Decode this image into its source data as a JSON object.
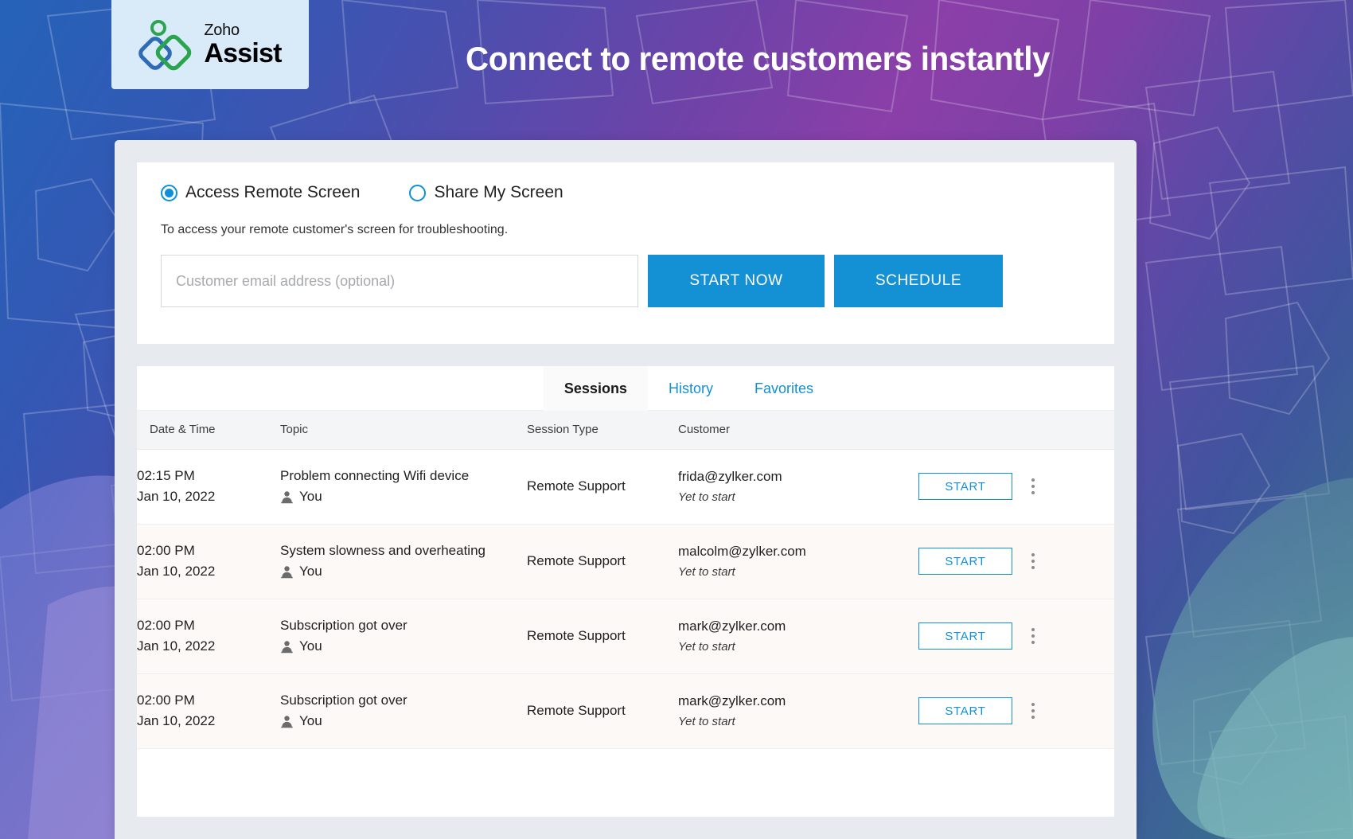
{
  "header": {
    "logo": {
      "brand_top": "Zoho",
      "brand_main": "Assist",
      "icon": "zoho-assist-logo-icon"
    },
    "headline": "Connect to remote customers instantly"
  },
  "connect_panel": {
    "options": [
      {
        "label": "Access Remote Screen",
        "selected": true
      },
      {
        "label": "Share My Screen",
        "selected": false
      }
    ],
    "description": "To access your remote customer's screen for troubleshooting.",
    "email_placeholder": "Customer email address (optional)",
    "email_value": "",
    "start_now_label": "START NOW",
    "schedule_label": "SCHEDULE"
  },
  "sessions_panel": {
    "tabs": [
      {
        "label": "Sessions",
        "active": true
      },
      {
        "label": "History",
        "active": false
      },
      {
        "label": "Favorites",
        "active": false
      }
    ],
    "columns": [
      "Date & Time",
      "Topic",
      "Session Type",
      "Customer",
      ""
    ],
    "rows": [
      {
        "time": "02:15 PM",
        "date": "Jan 10, 2022",
        "topic": "Problem connecting Wifi device",
        "owner": "You",
        "session_type": "Remote Support",
        "customer": "frida@zylker.com",
        "status": "Yet to start",
        "action_label": "START",
        "tinted": false
      },
      {
        "time": "02:00 PM",
        "date": "Jan 10, 2022",
        "topic": "System slowness and overheating",
        "owner": "You",
        "session_type": "Remote Support",
        "customer": "malcolm@zylker.com",
        "status": "Yet to start",
        "action_label": "START",
        "tinted": true
      },
      {
        "time": "02:00 PM",
        "date": "Jan 10, 2022",
        "topic": "Subscription got over",
        "owner": "You",
        "session_type": "Remote Support",
        "customer": "mark@zylker.com",
        "status": "Yet to start",
        "action_label": "START",
        "tinted": true
      },
      {
        "time": "02:00 PM",
        "date": "Jan 10, 2022",
        "topic": "Subscription got over",
        "owner": "You",
        "session_type": "Remote Support",
        "customer": "mark@zylker.com",
        "status": "Yet to start",
        "action_label": "START",
        "tinted": true
      }
    ]
  },
  "colors": {
    "accent_blue": "#1490d4",
    "logo_blue": "#2d6cb5",
    "logo_green": "#2aa44f",
    "logo_card_bg": "#d9eaf9",
    "window_bg": "#e7ebef",
    "row_tint": "#fdf9f7"
  }
}
